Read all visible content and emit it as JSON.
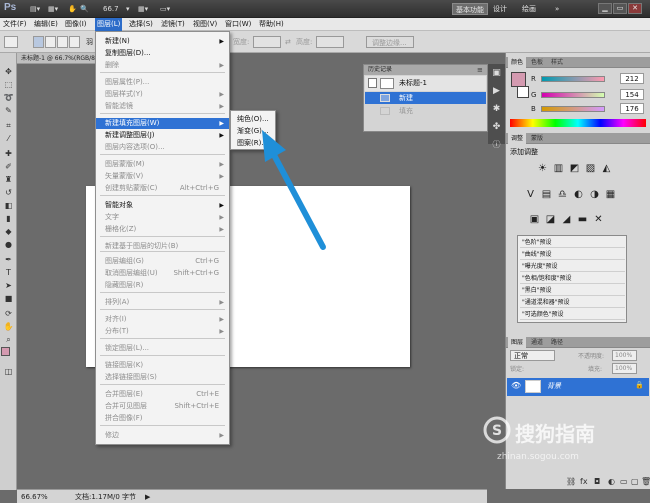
{
  "app": {
    "logo": "Ps",
    "zoom_readout": "66.7",
    "workspaces": [
      "基本功能",
      "设计",
      "绘画"
    ],
    "window_buttons": [
      "▁",
      "▭",
      "✕"
    ]
  },
  "menubar": [
    "文件(F)",
    "编辑(E)",
    "图像(I)",
    "图层(L)",
    "选择(S)",
    "滤镜(T)",
    "视图(V)",
    "窗口(W)",
    "帮助(H)"
  ],
  "optbar": {
    "feather_label": "羽",
    "width_label": "宽度:",
    "height_label": "高度:",
    "refine_label": "调整边缘..."
  },
  "document": {
    "tab_title": "未标题-1 @ 66.7%(RGB/8)"
  },
  "layer_menu": {
    "items": [
      {
        "label": "新建(N)",
        "arrow": "▶"
      },
      {
        "label": "复制图层(D)..."
      },
      {
        "label": "删除",
        "arrow": "▶",
        "disabled": true
      },
      {
        "label": "图层属性(P)...",
        "disabled": true
      },
      {
        "label": "图层样式(Y)",
        "arrow": "▶",
        "disabled": true
      },
      {
        "label": "智能滤镜",
        "arrow": "▶",
        "disabled": true
      },
      {
        "label": "新建填充图层(W)",
        "arrow": "▶",
        "highlight": true
      },
      {
        "label": "新建调整图层(J)",
        "arrow": "▶"
      },
      {
        "label": "图层内容选项(O)...",
        "disabled": true
      },
      {
        "label": "图层蒙版(M)",
        "arrow": "▶",
        "disabled": true
      },
      {
        "label": "矢量蒙版(V)",
        "arrow": "▶",
        "disabled": true
      },
      {
        "label": "创建剪贴蒙版(C)",
        "shortcut": "Alt+Ctrl+G",
        "disabled": true
      },
      {
        "label": "智能对象",
        "arrow": "▶"
      },
      {
        "label": "文字",
        "arrow": "▶",
        "disabled": true
      },
      {
        "label": "栅格化(Z)",
        "arrow": "▶",
        "disabled": true
      },
      {
        "label": "新建基于图层的切片(B)",
        "disabled": true
      },
      {
        "label": "图层编组(G)",
        "shortcut": "Ctrl+G",
        "disabled": true
      },
      {
        "label": "取消图层编组(U)",
        "shortcut": "Shift+Ctrl+G",
        "disabled": true
      },
      {
        "label": "隐藏图层(R)",
        "disabled": true
      },
      {
        "label": "排列(A)",
        "arrow": "▶",
        "disabled": true
      },
      {
        "label": "对齐(I)",
        "arrow": "▶",
        "disabled": true
      },
      {
        "label": "分布(T)",
        "arrow": "▶",
        "disabled": true
      },
      {
        "label": "锁定图层(L)...",
        "disabled": true
      },
      {
        "label": "链接图层(K)",
        "disabled": true
      },
      {
        "label": "选择链接图层(S)",
        "disabled": true
      },
      {
        "label": "合并图层(E)",
        "shortcut": "Ctrl+E",
        "disabled": true
      },
      {
        "label": "合并可见图层",
        "shortcut": "Shift+Ctrl+E",
        "disabled": true
      },
      {
        "label": "拼合图像(F)",
        "disabled": true
      },
      {
        "label": "修边",
        "arrow": "▶",
        "disabled": true
      }
    ]
  },
  "fill_submenu": [
    "纯色(O)...",
    "渐变(G)...",
    "图案(R)..."
  ],
  "history": {
    "title": "历史记录",
    "snapshot": "未标题-1",
    "state1": "新建",
    "state2": "填充"
  },
  "color_panel": {
    "tabs": [
      "颜色",
      "色板",
      "样式"
    ],
    "channels": [
      {
        "label": "R",
        "value": "212"
      },
      {
        "label": "G",
        "value": "154"
      },
      {
        "label": "B",
        "value": "176"
      }
    ],
    "fg_color": "#d49ab0"
  },
  "adjust_panel": {
    "tabs": [
      "调整",
      "蒙版"
    ],
    "heading": "添加调整",
    "icons_row1": [
      "☀",
      "▥",
      "◩",
      "▨",
      "◭"
    ],
    "icons_row2": [
      "V",
      "▤",
      "♎",
      "◐",
      "◑",
      "▦"
    ],
    "icons_row3": [
      "▣",
      "◪",
      "◢",
      "▬",
      "✕"
    ],
    "presets": [
      "\"色阶\"预设",
      "\"曲线\"预设",
      "\"曝光度\"预设",
      "\"色相/饱和度\"预设",
      "\"黑白\"预设",
      "\"通道混和器\"预设",
      "\"可选颜色\"预设"
    ]
  },
  "layers_panel": {
    "tabs": [
      "图层",
      "通道",
      "路径"
    ],
    "blend_mode": "正常",
    "opacity_label": "不透明度:",
    "opacity": "100%",
    "lock_label": "锁定:",
    "fill_label": "填充:",
    "fill": "100%",
    "layer_name": "背景"
  },
  "status": {
    "zoom": "66.67%",
    "doc_info": "文档:1.17M/0 字节"
  },
  "watermark": {
    "brand": "搜狗指南",
    "url": "zhinan.sogou.com"
  }
}
